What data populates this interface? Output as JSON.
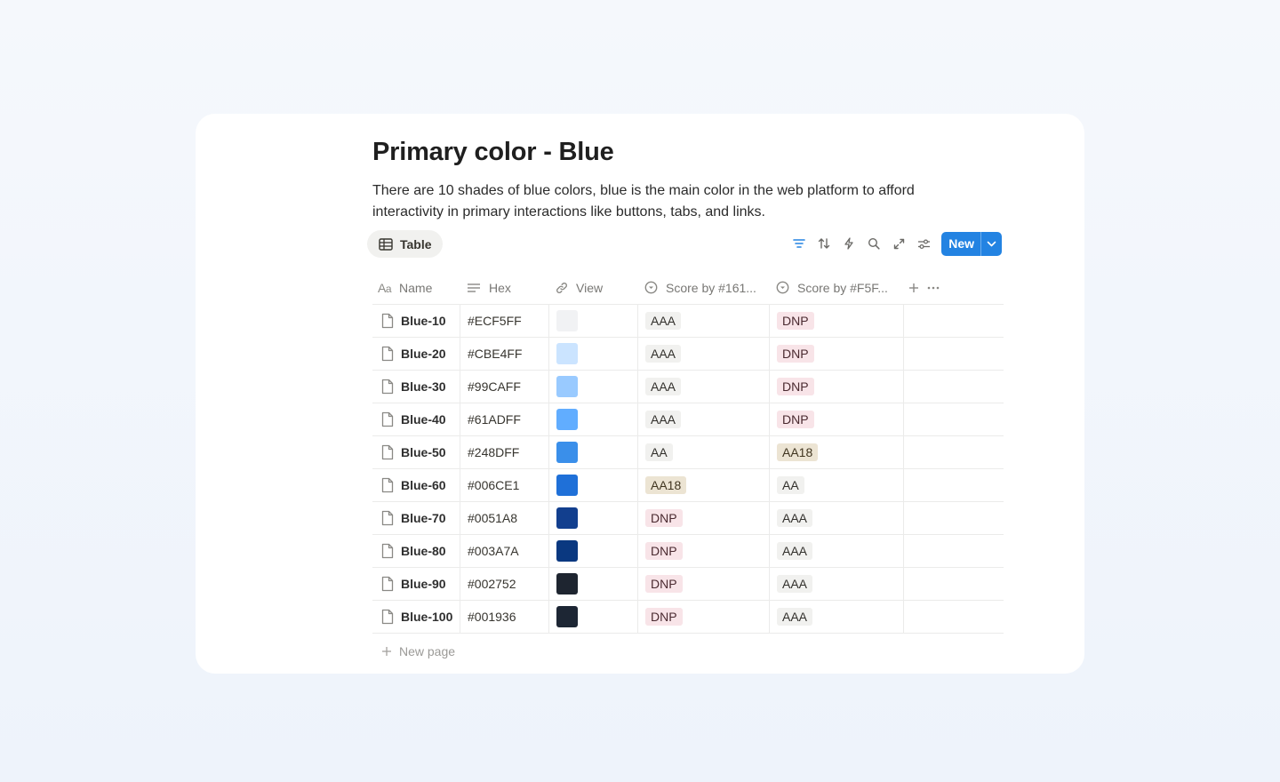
{
  "page": {
    "title": "Primary color - Blue",
    "description": "There are 10 shades of blue colors, blue is the main color in the web platform to afford interactivity in primary interactions like buttons, tabs, and links."
  },
  "view_tab": {
    "label": "Table",
    "icon": "table-icon"
  },
  "toolbar": {
    "icons": [
      "filter-icon",
      "sort-icon",
      "lightning-icon",
      "search-icon",
      "expand-icon",
      "settings-icon"
    ],
    "new_label": "New"
  },
  "columns": {
    "name": "Name",
    "hex": "Hex",
    "view": "View",
    "score1": "Score by #161...",
    "score2": "Score by #F5F..."
  },
  "rows": [
    {
      "name": "Blue-10",
      "hex": "#ECF5FF",
      "score1": "AAA",
      "score2": "DNP"
    },
    {
      "name": "Blue-20",
      "hex": "#CBE4FF",
      "score1": "AAA",
      "score2": "DNP"
    },
    {
      "name": "Blue-30",
      "hex": "#99CAFF",
      "score1": "AAA",
      "score2": "DNP"
    },
    {
      "name": "Blue-40",
      "hex": "#61ADFF",
      "score1": "AAA",
      "score2": "DNP"
    },
    {
      "name": "Blue-50",
      "hex": "#248DFF",
      "score1": "AA",
      "score2": "AA18"
    },
    {
      "name": "Blue-60",
      "hex": "#006CE1",
      "score1": "AA18",
      "score2": "AA"
    },
    {
      "name": "Blue-70",
      "hex": "#0051A8",
      "score1": "DNP",
      "score2": "AAA"
    },
    {
      "name": "Blue-80",
      "hex": "#003A7A",
      "score1": "DNP",
      "score2": "AAA"
    },
    {
      "name": "Blue-90",
      "hex": "#002752",
      "score1": "DNP",
      "score2": "AAA"
    },
    {
      "name": "Blue-100",
      "hex": "#001936",
      "score1": "DNP",
      "score2": "AAA"
    }
  ],
  "new_page_label": "New page",
  "colors": {
    "accent": "#2383E2",
    "swatches": [
      "#F1F2F4",
      "#CBE4FF",
      "#99CAFF",
      "#61ADFF",
      "#3A8FEA",
      "#1F70D8",
      "#123F8E",
      "#0A3880",
      "#1E2530",
      "#1D2634"
    ]
  }
}
